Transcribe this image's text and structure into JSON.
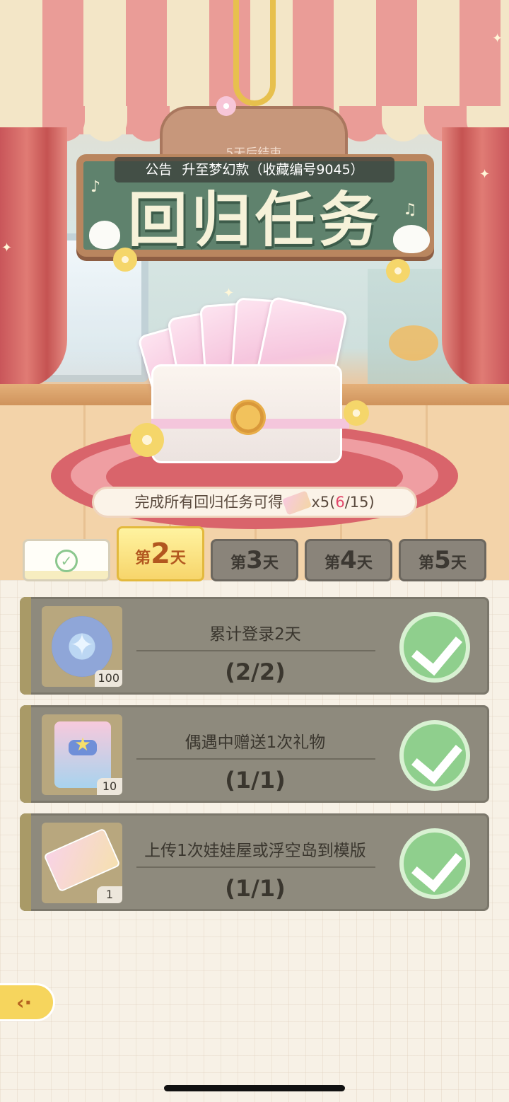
{
  "header": {
    "countdown": "5天后结束",
    "title": "回归任务",
    "announcement_label": "公告",
    "announcement_text": "升至梦幻款（收藏编号9045）"
  },
  "reward": {
    "text_prefix": "完成所有回归任务可得",
    "item_icon": "ticket-icon",
    "multiplier": "x5",
    "progress_open": "(",
    "progress_current": "6",
    "progress_total": "/15)"
  },
  "tabs": [
    {
      "state": "completed",
      "icon": "check-icon"
    },
    {
      "pre": "第",
      "num": "2",
      "post": "天",
      "state": "active"
    },
    {
      "pre": "第",
      "num": "3",
      "post": "天",
      "state": "locked"
    },
    {
      "pre": "第",
      "num": "4",
      "post": "天",
      "state": "locked"
    },
    {
      "pre": "第",
      "num": "5",
      "post": "天",
      "state": "locked"
    }
  ],
  "tasks": [
    {
      "title": "累计登录2天",
      "progress": "(2/2)",
      "reward_icon": "star-coin-icon",
      "reward_qty": "100",
      "completed": true
    },
    {
      "title": "偶遇中赠送1次礼物",
      "progress": "(1/1)",
      "reward_icon": "gift-bag-icon",
      "reward_qty": "10",
      "completed": true
    },
    {
      "title": "上传1次娃娃屋或浮空岛到模版",
      "progress": "(1/1)",
      "reward_icon": "ticket-icon",
      "reward_qty": "1",
      "completed": true
    }
  ],
  "colors": {
    "accent_yellow": "#f7d56b",
    "task_bg": "#8e8a7d",
    "check_green": "#8fcf8d",
    "progress_highlight": "#e2476a"
  }
}
